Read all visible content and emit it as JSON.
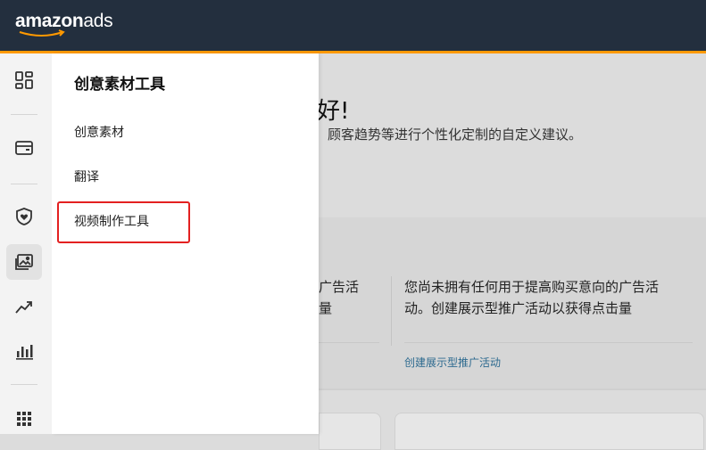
{
  "header": {
    "logo": {
      "brand": "amazon",
      "suffix": "ads"
    },
    "colors": {
      "bar": "#232f3e",
      "accent": "#ff9900"
    }
  },
  "rail": {
    "icons": [
      "dashboard-icon",
      "campaign-wallet-icon",
      "brand-shield-icon",
      "creative-image-icon",
      "trend-chart-icon",
      "bar-chart-icon",
      "apps-grid-icon"
    ],
    "active": "creative-image-icon"
  },
  "panel": {
    "title": "创意素材工具",
    "items": [
      {
        "label": "创意素材"
      },
      {
        "label": "翻译"
      },
      {
        "label": "视频制作工具",
        "highlighted": true
      }
    ],
    "highlight_color": "#e32020"
  },
  "main": {
    "greeting": "好!",
    "subtitle": "顾客趋势等进行个性化定制的自定义建议。",
    "card1": {
      "line1": "广告活",
      "line2": "量"
    },
    "card2": {
      "line1": "您尚未拥有任何用于提高购买意向的广告活",
      "line2": "动。创建展示型推广活动以获得点击量",
      "link": "创建展示型推广活动"
    },
    "link_color": "#2d6a8f"
  }
}
